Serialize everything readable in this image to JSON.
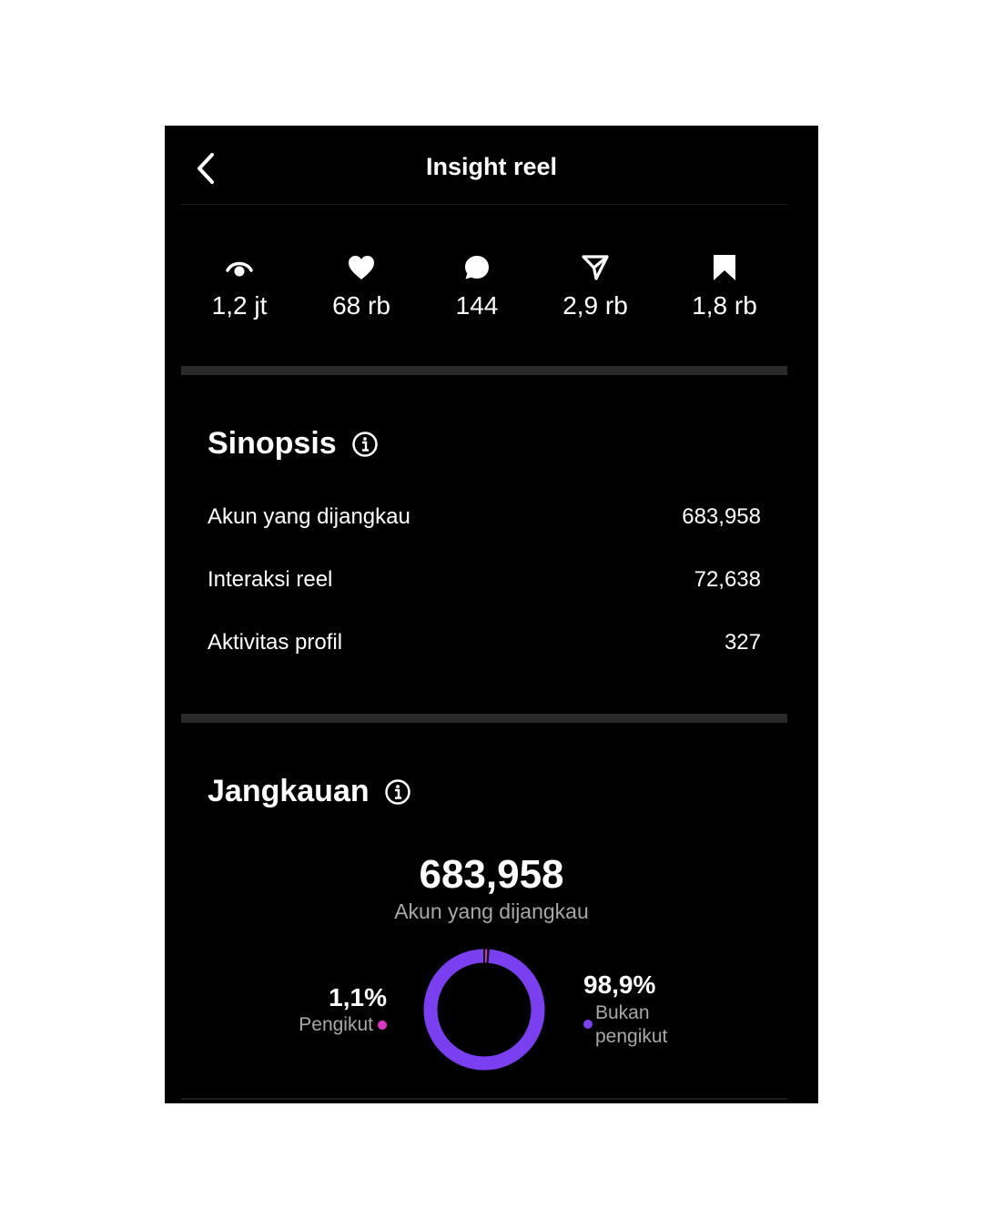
{
  "header": {
    "title": "Insight reel"
  },
  "stats": [
    {
      "icon": "eye-icon",
      "value": "1,2 jt"
    },
    {
      "icon": "heart-icon",
      "value": "68 rb"
    },
    {
      "icon": "comment-icon",
      "value": "144"
    },
    {
      "icon": "share-icon",
      "value": "2,9 rb"
    },
    {
      "icon": "bookmark-icon",
      "value": "1,8 rb"
    }
  ],
  "overview": {
    "title": "Sinopsis",
    "rows": [
      {
        "label": "Akun yang dijangkau",
        "value": "683,958"
      },
      {
        "label": "Interaksi reel",
        "value": "72,638"
      },
      {
        "label": "Aktivitas profil",
        "value": "327"
      }
    ]
  },
  "reach": {
    "title": "Jangkauan",
    "total": "683,958",
    "total_label": "Akun yang dijangkau",
    "followers": {
      "percent_text": "1,1%",
      "label": "Pengikut",
      "fraction": 0.011,
      "color": "#e032c8"
    },
    "non_followers": {
      "percent_text": "98,9%",
      "label": "Bukan pengikut",
      "fraction": 0.989,
      "color": "#7b3ff2"
    }
  }
}
